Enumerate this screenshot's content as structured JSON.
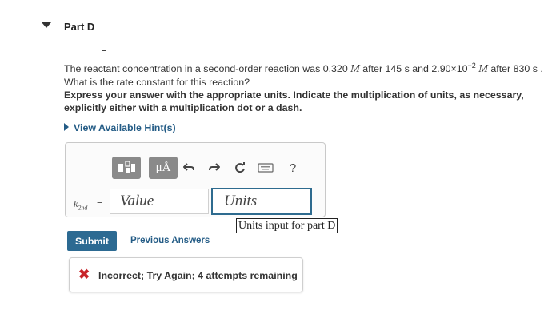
{
  "part": {
    "title": "Part D"
  },
  "question": {
    "text_1": "The reactant concentration in a second-order reaction was 0.320 ",
    "unit_M": "M",
    "text_2": " after 145 s and 2.90×10",
    "exponent": "−2",
    "text_3": " after 830 s . What is the rate constant for this reaction?"
  },
  "instruction": "Express your answer with the appropriate units. Indicate the multiplication of units, as necessary, explicitly either with a multiplication dot or a dash.",
  "hint": {
    "label": "View Available Hint(s)"
  },
  "toolbar": {
    "mu_label": "μÅ",
    "help_label": "?"
  },
  "answer": {
    "variable": "k",
    "variable_sub": "2nd",
    "equals": "=",
    "value_placeholder": "Value",
    "units_placeholder": "Units",
    "units_tooltip": "Units input for part D"
  },
  "actions": {
    "submit_label": "Submit",
    "previous_answers_label": "Previous Answers"
  },
  "feedback": {
    "icon": "✖",
    "message": "Incorrect; Try Again; 4 attempts remaining"
  },
  "colors": {
    "accent": "#2c6a92",
    "link": "#245c86",
    "error": "#c8242a"
  }
}
